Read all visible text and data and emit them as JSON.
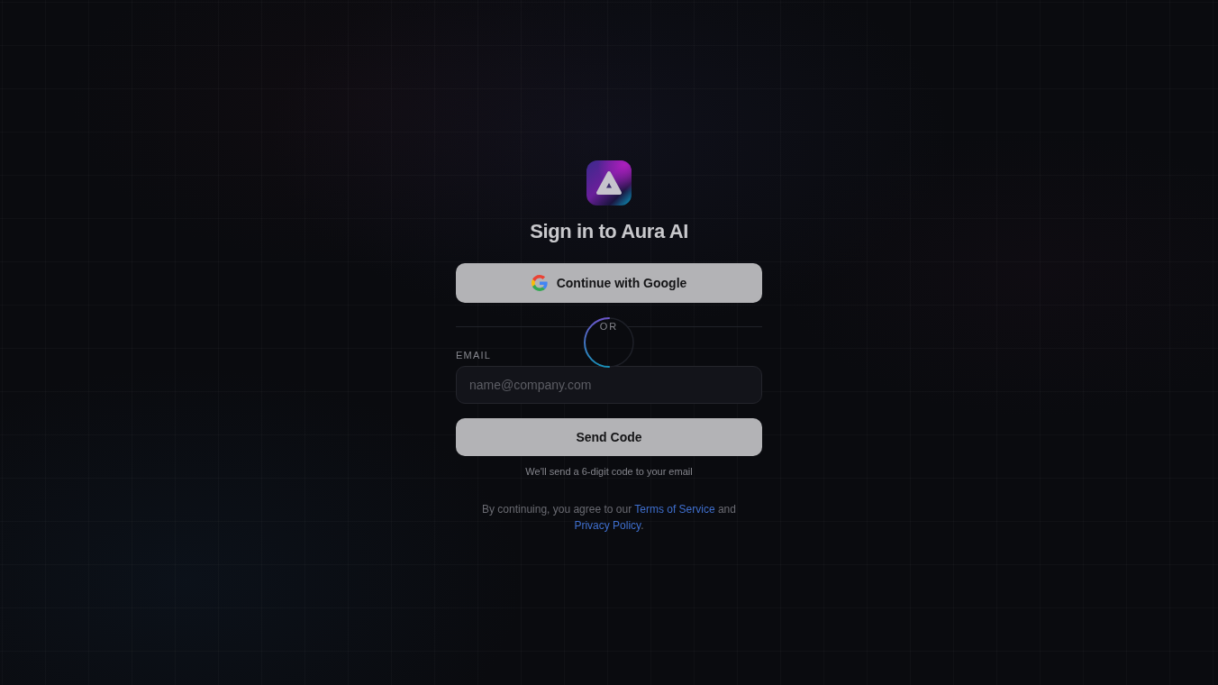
{
  "title": "Sign in to Aura AI",
  "google_button": {
    "label": "Continue with Google"
  },
  "divider": {
    "label": "OR"
  },
  "loading": true,
  "email": {
    "label": "EMAIL",
    "placeholder": "name@company.com"
  },
  "send_button": {
    "label": "Send Code"
  },
  "hint": "We'll send a 6-digit code to your email",
  "legal": {
    "parts": [
      {
        "kind": "text",
        "text": "By continuing, you agree to our "
      },
      {
        "kind": "link",
        "text": "Terms of Service"
      },
      {
        "kind": "text",
        "text": " and "
      },
      {
        "kind": "link",
        "text": "Privacy Policy"
      },
      {
        "kind": "text",
        "text": "."
      }
    ]
  }
}
